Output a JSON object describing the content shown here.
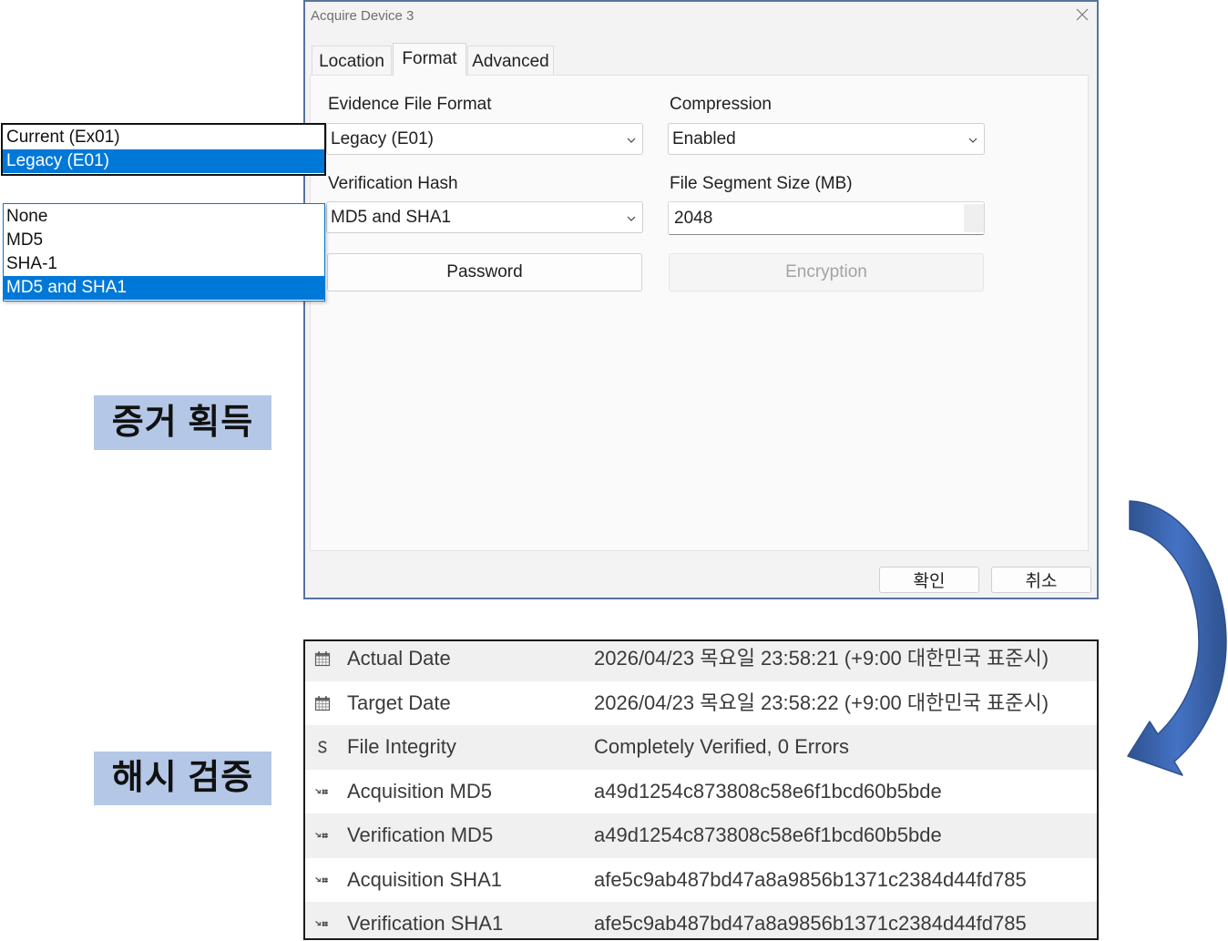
{
  "dialog": {
    "title": "Acquire Device 3",
    "tabs": [
      "Location",
      "Format",
      "Advanced"
    ],
    "selected_tab": 1,
    "evidence_file_format": {
      "label": "Evidence File Format",
      "value": "Legacy (E01)"
    },
    "compression": {
      "label": "Compression",
      "value": "Enabled"
    },
    "verification_hash": {
      "label": "Verification Hash",
      "value": "MD5 and SHA1"
    },
    "file_segment_size": {
      "label": "File Segment Size (MB)",
      "value": "2048"
    },
    "password_button": "Password",
    "encryption_button": "Encryption",
    "encryption_enabled": false,
    "ok_button": "확인",
    "cancel_button": "취소"
  },
  "format_dropdown": {
    "options": [
      "Current (Ex01)",
      "Legacy (E01)"
    ],
    "selected_index": 1
  },
  "hash_dropdown": {
    "options": [
      "None",
      "MD5",
      "SHA-1",
      "MD5 and SHA1"
    ],
    "selected_index": 3
  },
  "captions": {
    "acquisition": "증거 획득",
    "hash_verification": "해시 검증"
  },
  "results": [
    {
      "icon": "calendar-icon",
      "label": "Actual Date",
      "value": "2026/04/23 목요일 23:58:21 (+9:00 대한민국 표준시)"
    },
    {
      "icon": "calendar-icon",
      "label": "Target Date",
      "value": "2026/04/23 목요일 23:58:22 (+9:00 대한민국 표준시)"
    },
    {
      "icon": "integrity-icon",
      "label": "File Integrity",
      "value": "Completely Verified, 0 Errors"
    },
    {
      "icon": "hash-icon",
      "label": "Acquisition MD5",
      "value": "a49d1254c873808c58e6f1bcd60b5bde"
    },
    {
      "icon": "hash-icon",
      "label": "Verification MD5",
      "value": "a49d1254c873808c58e6f1bcd60b5bde"
    },
    {
      "icon": "hash-icon",
      "label": "Acquisition SHA1",
      "value": "afe5c9ab487bd47a8a9856b1371c2384d44fd785"
    },
    {
      "icon": "hash-icon",
      "label": "Verification SHA1",
      "value": "afe5c9ab487bd47a8a9856b1371c2384d44fd785"
    }
  ],
  "icons": {
    "close": "close-icon",
    "select": "chevron-down-icon",
    "arrow": "curved-arrow"
  },
  "colors": {
    "selection": "#0078d7",
    "caption_bg": "#b4c7e7",
    "arrow": "#4472c4",
    "arrow_outline": "#2f528f"
  }
}
